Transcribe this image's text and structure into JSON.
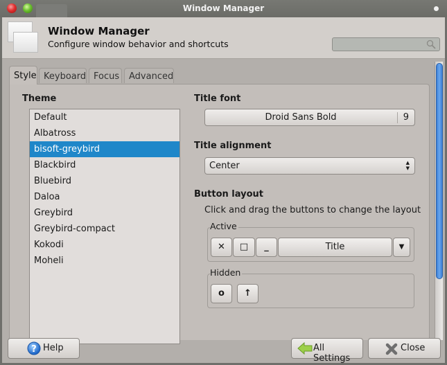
{
  "titlebar": {
    "title": "Window Manager"
  },
  "header": {
    "title": "Window Manager",
    "subtitle": "Configure window behavior and shortcuts",
    "search_placeholder": ""
  },
  "tabs": [
    {
      "label": "Style",
      "active": true
    },
    {
      "label": "Keyboard",
      "active": false
    },
    {
      "label": "Focus",
      "active": false
    },
    {
      "label": "Advanced",
      "active": false
    }
  ],
  "theme": {
    "label": "Theme",
    "selected": "bisoft-greybird",
    "items": [
      "Default",
      "Albatross",
      "bisoft-greybird",
      "Blackbird",
      "Bluebird",
      "Daloa",
      "Greybird",
      "Greybird-compact",
      "Kokodi",
      "Moheli"
    ]
  },
  "title_font": {
    "label": "Title font",
    "font_name": "Droid Sans Bold",
    "font_size": "9"
  },
  "title_alignment": {
    "label": "Title alignment",
    "value": "Center"
  },
  "button_layout": {
    "label": "Button layout",
    "description": "Click and drag the buttons to change the layout",
    "active_label": "Active",
    "active_buttons": [
      {
        "name": "close",
        "glyph": "✕"
      },
      {
        "name": "maximize",
        "glyph": "□"
      },
      {
        "name": "minimize",
        "glyph": "_"
      },
      {
        "name": "title",
        "glyph": "Title"
      },
      {
        "name": "menu",
        "glyph": "▼"
      }
    ],
    "hidden_label": "Hidden",
    "hidden_buttons": [
      {
        "name": "stick",
        "glyph": "o"
      },
      {
        "name": "shade",
        "glyph": "↑"
      }
    ]
  },
  "footer": {
    "help": "Help",
    "all_settings": "All Settings",
    "close": "Close"
  },
  "colors": {
    "selection": "#1f87c9",
    "scrollbar": "#4a8fe0"
  }
}
